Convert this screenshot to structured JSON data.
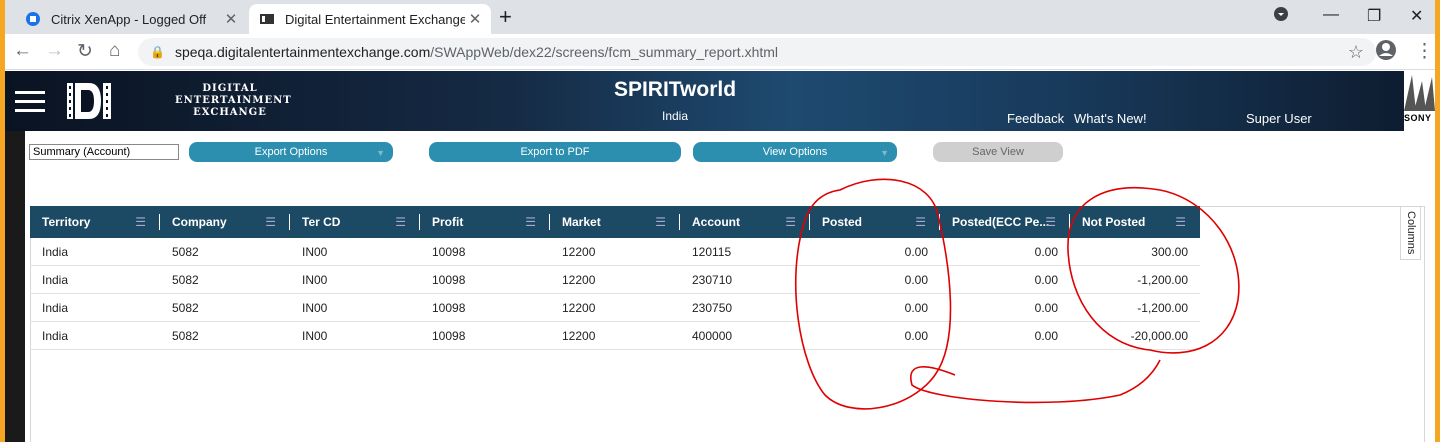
{
  "browser": {
    "tabs": [
      {
        "label": "Citrix XenApp - Logged Off",
        "active": false
      },
      {
        "label": "Digital Entertainment Exchange",
        "active": true
      }
    ],
    "url_host": "speqa.digitalentertainmentexchange.com",
    "url_path": "/SWAppWeb/dex22/screens/fcm_summary_report.xhtml"
  },
  "header": {
    "logo_line1": "DIGITAL",
    "logo_line2": "ENTERTAINMENT",
    "logo_line3": "EXCHANGE",
    "app_title": "SPIRITworld",
    "region": "India",
    "links": [
      "Feedback",
      "What's New!"
    ],
    "user": "Super User",
    "brand": "SONY"
  },
  "controls": {
    "report_select": "Summary (Account)",
    "export_options": "Export Options",
    "export_pdf": "Export to PDF",
    "view_options": "View Options",
    "save_view": "Save View"
  },
  "grid": {
    "columns": [
      "Territory",
      "Company",
      "Ter CD",
      "Profit",
      "Market",
      "Account",
      "Posted",
      "Posted(ECC Pe...",
      "Not Posted"
    ],
    "rows": [
      [
        "India",
        "5082",
        "IN00",
        "10098",
        "12200",
        "120115",
        "0.00",
        "0.00",
        "300.00"
      ],
      [
        "India",
        "5082",
        "IN00",
        "10098",
        "12200",
        "230710",
        "0.00",
        "0.00",
        "-1,200.00"
      ],
      [
        "India",
        "5082",
        "IN00",
        "10098",
        "12200",
        "230750",
        "0.00",
        "0.00",
        "-1,200.00"
      ],
      [
        "India",
        "5082",
        "IN00",
        "10098",
        "12200",
        "400000",
        "0.00",
        "0.00",
        "-20,000.00"
      ]
    ],
    "columns_panel_label": "Columns"
  },
  "colors": {
    "frame": "#f5a623",
    "grid_header": "#1c4a64",
    "button": "#2c8fb0",
    "annotation": "#e00000"
  }
}
